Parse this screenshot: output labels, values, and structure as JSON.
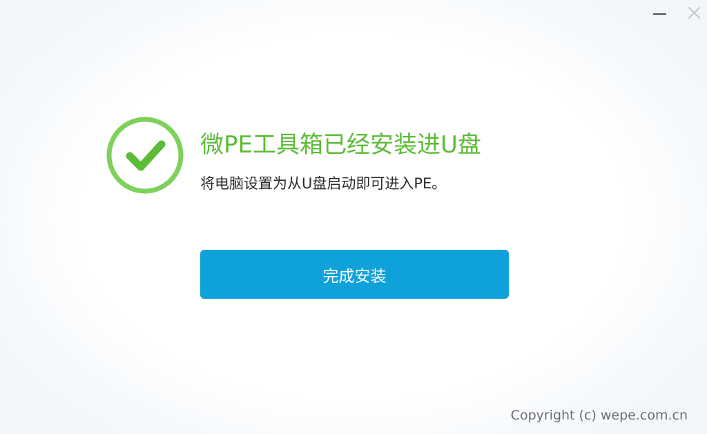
{
  "window": {
    "controls": {
      "minimize_icon": "minimize-icon",
      "close_icon": "close-icon"
    }
  },
  "result": {
    "status_icon": "check-circle-icon",
    "title": "微PE工具箱已经安装进U盘",
    "subtitle": "将电脑设置为从U盘启动即可进入PE。",
    "finish_button_label": "完成安装"
  },
  "footer": {
    "copyright": "Copyright (c) wepe.com.cn"
  },
  "colors": {
    "success_green": "#5cbc37",
    "check_green": "#7ed15a",
    "button_blue": "#0ea1da"
  }
}
